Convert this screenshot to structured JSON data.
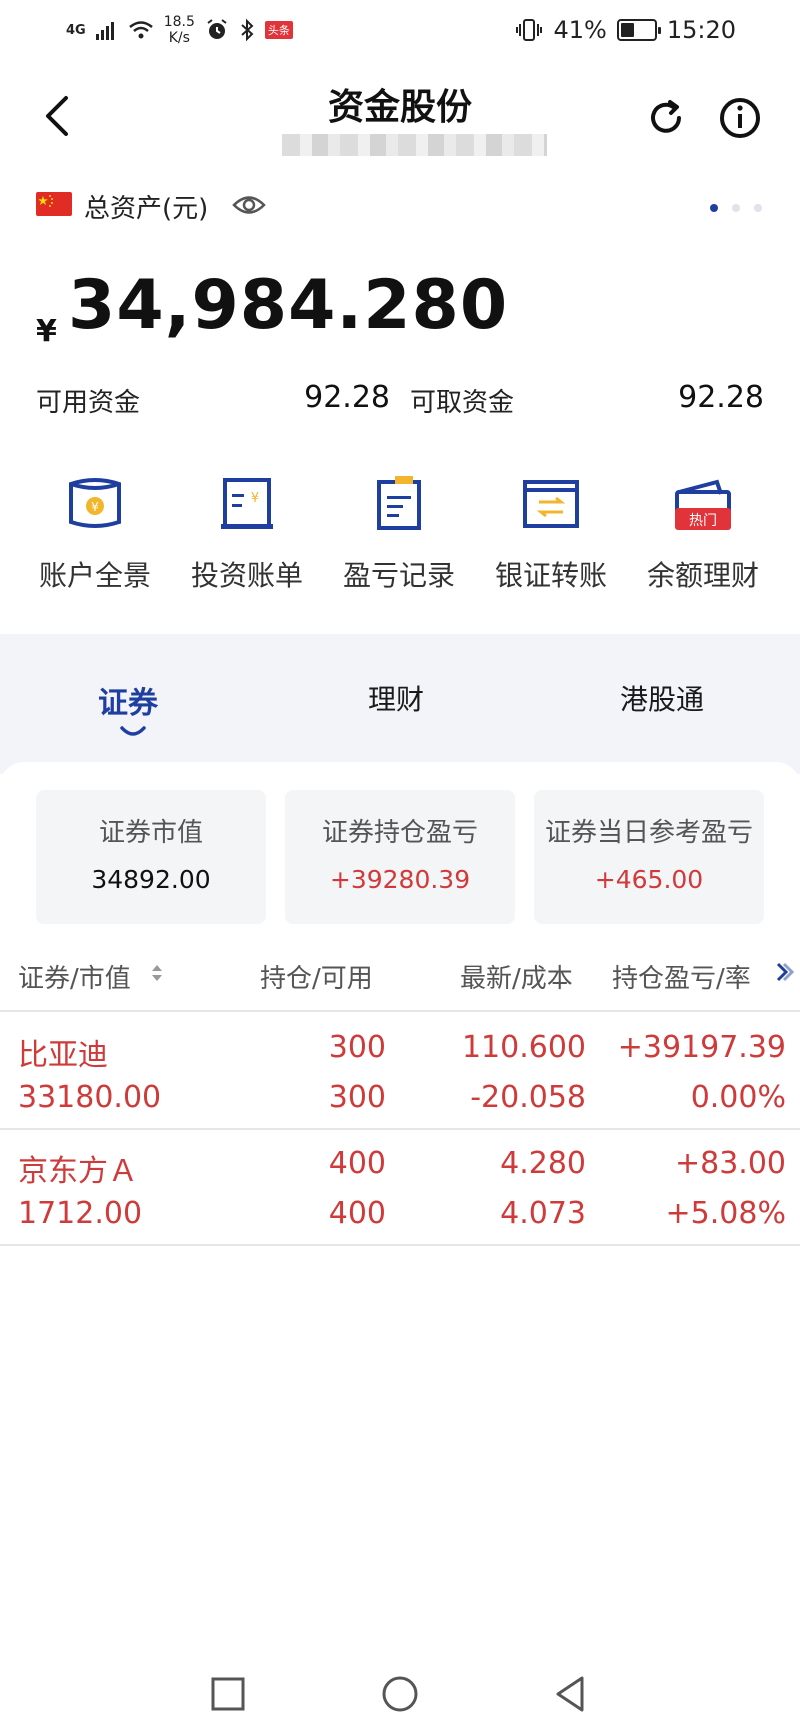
{
  "status_bar": {
    "network": "4G",
    "speed": "18.5",
    "speed_unit": "K/s",
    "news_badge": "头条",
    "battery_percent": "41%",
    "battery_level": 0.41,
    "time": "15:20"
  },
  "header": {
    "title": "资金股份"
  },
  "asset": {
    "label": "总资产(元)",
    "currency": "¥",
    "total": "34,984.280",
    "available_label": "可用资金",
    "available_value": "92.28",
    "withdrawable_label": "可取资金",
    "withdrawable_value": "92.28"
  },
  "quick_actions": [
    {
      "label": "账户全景",
      "icon": "account-overview-icon"
    },
    {
      "label": "投资账单",
      "icon": "investment-bill-icon"
    },
    {
      "label": "盈亏记录",
      "icon": "profit-record-icon"
    },
    {
      "label": "银证转账",
      "icon": "bank-transfer-icon"
    },
    {
      "label": "余额理财",
      "icon": "balance-finance-icon",
      "badge": "热门"
    }
  ],
  "tabs": [
    "证券",
    "理财",
    "港股通"
  ],
  "stats": [
    {
      "label": "证券市值",
      "value": "34892.00"
    },
    {
      "label": "证券持仓盈亏",
      "value": "+39280.39"
    },
    {
      "label": "证券当日参考盈亏",
      "value": "+465.00"
    }
  ],
  "table": {
    "headers": [
      "证券/市值",
      "持仓/可用",
      "最新/成本",
      "持仓盈亏/率"
    ],
    "rows": [
      {
        "name": "比亚迪",
        "market_value": "33180.00",
        "holding": "300",
        "available": "300",
        "latest": "110.600",
        "cost": "-20.058",
        "pl": "+39197.39",
        "pl_rate": "0.00%"
      },
      {
        "name": "京东方Ａ",
        "market_value": "1712.00",
        "holding": "400",
        "available": "400",
        "latest": "4.280",
        "cost": "4.073",
        "pl": "+83.00",
        "pl_rate": "+5.08%"
      }
    ]
  },
  "colors": {
    "accent": "#1f3fa0",
    "profit": "#cf3a3a",
    "band": "#f3f4f9"
  }
}
